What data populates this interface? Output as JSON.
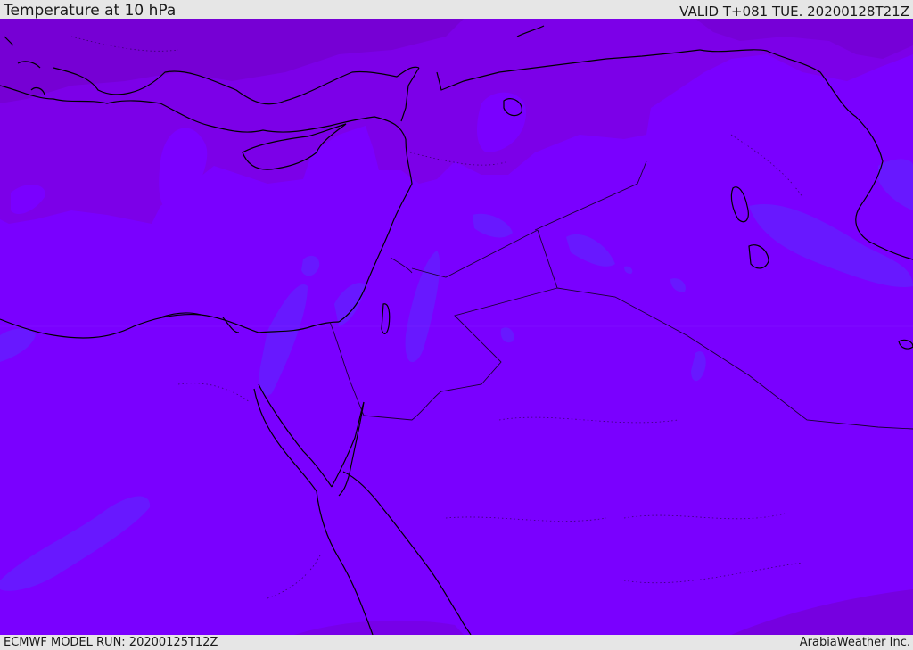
{
  "header": {
    "title": "Temperature at 10 hPa",
    "valid": "VALID T+081 TUE. 20200128T21Z"
  },
  "footer": {
    "model_run": "ECMWF MODEL RUN: 20200125T12Z",
    "brand": "ArabiaWeather Inc."
  },
  "map": {
    "field": "temperature",
    "level": "10 hPa",
    "colors": {
      "base": "#7a00ff",
      "cooler": "#7c00e8",
      "coldest": "#7300cc",
      "warmer": "#5a2cff",
      "coastline": "#000000",
      "border": "#1a0033"
    }
  }
}
